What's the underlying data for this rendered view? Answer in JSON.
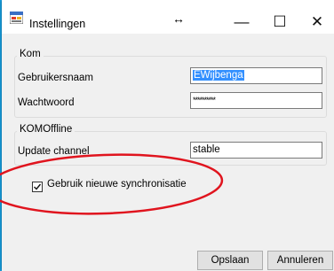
{
  "window": {
    "title": "Instellingen",
    "resize_glyph": "↔",
    "minimize": "—",
    "maximize": "☐",
    "close": "✕"
  },
  "groups": {
    "kom": {
      "label": "Kom",
      "username_label": "Gebruikersnaam",
      "username_value": "EWijbenga",
      "password_label": "Wachtwoord",
      "password_value": "**********"
    },
    "komoffline": {
      "label": "KOMOffline",
      "channel_label": "Update channel",
      "channel_value": "stable"
    }
  },
  "checkbox": {
    "label": "Gebruik nieuwe synchronisatie",
    "checked": true
  },
  "buttons": {
    "save": "Opslaan",
    "cancel": "Annuleren"
  },
  "annotation": {
    "color": "#e0141e",
    "shape": "ellipse"
  },
  "colors": {
    "desktop": "#17a8ee",
    "selection": "#3390ff"
  }
}
